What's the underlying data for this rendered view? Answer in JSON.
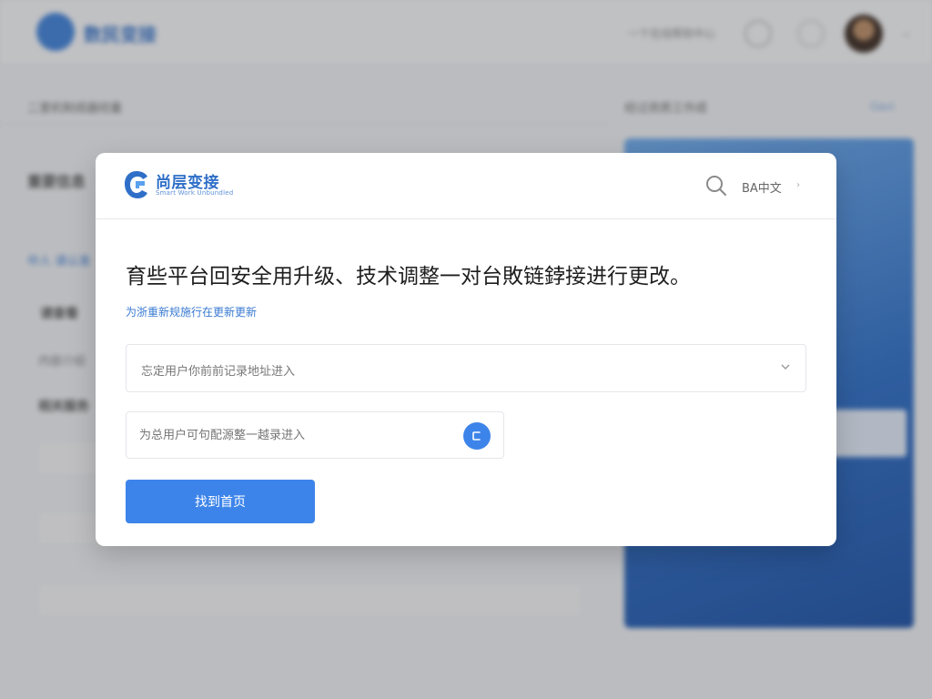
{
  "background": {
    "brand": "数民变接",
    "header_link": "一个在线帮助中心",
    "section_title": "二里机制成器经量",
    "right_title": "经过资质工作成",
    "right_link": "Gavi",
    "text_a": "重要信息",
    "text_b": "中人 请认准",
    "text_c": "请查看",
    "text_d": "内容介绍",
    "text_e": "相关服务"
  },
  "modal": {
    "logo_text": "尚层变接",
    "logo_sub": "Smart Work Unbundled",
    "lang_label": "BA中文",
    "heading": "育些平台回安全用升级、技术调整一对台敗链鋍接进行更改。",
    "subtitle": "为浙重新规施行在更新更新",
    "select_placeholder": "忘定用户你前前记录地址进入",
    "input_placeholder": "为总用户可句配源整一越录进入",
    "primary_button": "找到首页"
  },
  "colors": {
    "accent": "#3d84ea",
    "brand_blue": "#2f6fc8",
    "overlay": "rgba(60,62,66,0.28)"
  },
  "icons": {
    "search": "search-icon",
    "chevron": "chevron-down-icon",
    "copy": "copy-icon",
    "logo": "logo-icon"
  }
}
